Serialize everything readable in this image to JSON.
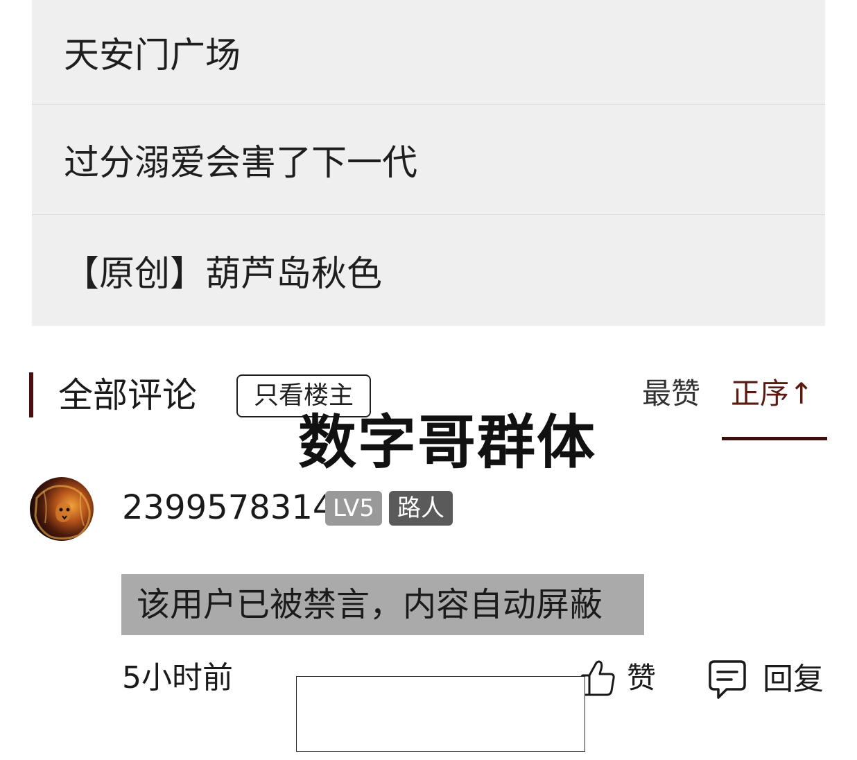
{
  "related_list": {
    "items": [
      {
        "label": "天安门广场"
      },
      {
        "label": "过分溺爱会害了下一代"
      },
      {
        "label": "【原创】葫芦岛秋色"
      }
    ]
  },
  "comments_header": {
    "title": "全部评论",
    "op_only_label": "只看楼主",
    "sort_most_liked": "最赞",
    "sort_ascending": "正序↑",
    "active_sort": "正序"
  },
  "watermark": {
    "text": "数字哥群体"
  },
  "comment": {
    "avatar_icon": "lion-avatar",
    "username": "2399578314",
    "level_badge": "LV5",
    "rank_badge": "路人",
    "content": "该用户已被禁言，内容自动屏蔽",
    "time": "5小时前",
    "like_icon": "thumbs-up-icon",
    "like_label": "赞",
    "reply_icon": "comment-bubble-icon",
    "reply_label": "回复"
  },
  "colors": {
    "list_background": "#efefef",
    "accent_dark_red": "#4a0f0f",
    "level_badge_bg": "#999999",
    "rank_badge_bg": "#5a5a5a",
    "blocked_content_bg": "#aaaaaa"
  }
}
